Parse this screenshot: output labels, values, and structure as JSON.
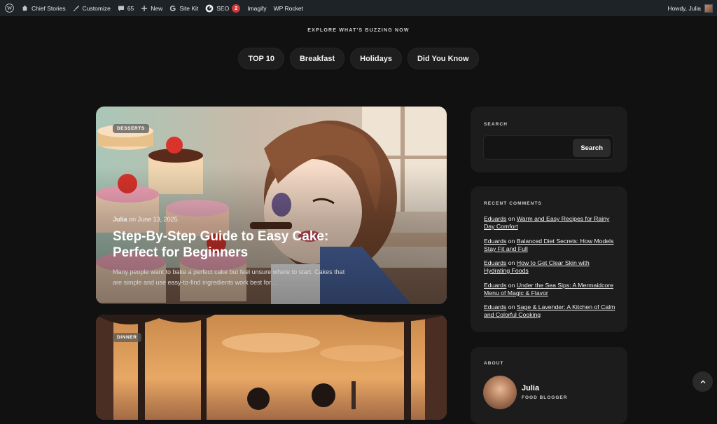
{
  "adminbar": {
    "site_name": "Chief Stories",
    "customize": "Customize",
    "comments_count": "65",
    "new": "New",
    "site_kit": "Site Kit",
    "seo": "SEO",
    "seo_badge": "2",
    "imagify": "Imagify",
    "wp_rocket": "WP Rocket",
    "howdy": "Howdy, Julia"
  },
  "explore": {
    "heading": "EXPLORE WHAT'S BUZZING NOW",
    "pills": [
      "TOP 10",
      "Breakfast",
      "Holidays",
      "Did You Know"
    ]
  },
  "posts": [
    {
      "category": "DESSERTS",
      "author": "Julia",
      "date_prefix": "on",
      "date": "June 13, 2025",
      "title": "Step-By-Step Guide to Easy Cake: Perfect for Beginners",
      "excerpt": "Many people want to bake a perfect cake but feel unsure where to start. Cakes that are simple and use easy-to-find ingredients work best for…"
    },
    {
      "category": "DINNER"
    }
  ],
  "sidebar": {
    "search": {
      "title": "SEARCH",
      "placeholder": "",
      "button": "Search"
    },
    "recent_comments": {
      "title": "RECENT COMMENTS",
      "items": [
        {
          "author": "Eduards",
          "on": "on",
          "post": "Warm and Easy Recipes for Rainy Day Comfort"
        },
        {
          "author": "Eduards",
          "on": "on",
          "post": "Balanced Diet Secrets: How Models Stay Fit and Full"
        },
        {
          "author": "Eduards",
          "on": "on",
          "post": "How to Get Clear Skin with Hydrating Foods"
        },
        {
          "author": "Eduards",
          "on": "on",
          "post": "Under the Sea Sips: A Mermaidcore Menu of Magic & Flavor"
        },
        {
          "author": "Eduards",
          "on": "on",
          "post": "Sage & Lavender: A Kitchen of Calm and Colorful Cooking"
        }
      ]
    },
    "about": {
      "title": "ABOUT",
      "name": "Julia",
      "role": "FOOD BLOGGER"
    }
  },
  "colors": {
    "background": "#111111",
    "widget": "#1c1c1c",
    "adminbar": "#1d2327",
    "badge": "#d63638"
  }
}
